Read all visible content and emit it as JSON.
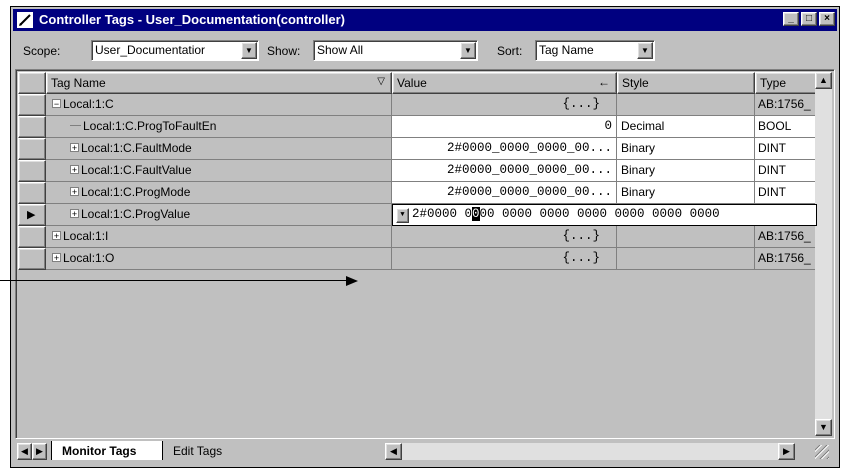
{
  "window": {
    "title": "Controller Tags - User_Documentation(controller)"
  },
  "toolbar": {
    "scope_label": "Scope:",
    "scope_value": "User_Documentatior",
    "show_label": "Show:",
    "show_value": "Show All",
    "sort_label": "Sort:",
    "sort_value": "Tag Name"
  },
  "grid": {
    "headers": {
      "tag_name": "Tag Name",
      "value": "Value",
      "style": "Style",
      "type": "Type"
    },
    "rows": [
      {
        "tag": "Local:1:C",
        "value": "{...}",
        "style": "",
        "type": "AB:1756_",
        "tree": "minus",
        "indent": 0
      },
      {
        "tag": "Local:1:C.ProgToFaultEn",
        "value": "0",
        "style": "Decimal",
        "type": "BOOL",
        "tree": "leaf",
        "indent": 1
      },
      {
        "tag": "Local:1:C.FaultMode",
        "value": "2#0000_0000_0000_00...",
        "style": "Binary",
        "type": "DINT",
        "tree": "plus",
        "indent": 1
      },
      {
        "tag": "Local:1:C.FaultValue",
        "value": "2#0000_0000_0000_00...",
        "style": "Binary",
        "type": "DINT",
        "tree": "plus",
        "indent": 1
      },
      {
        "tag": "Local:1:C.ProgMode",
        "value": "2#0000_0000_0000_00...",
        "style": "Binary",
        "type": "DINT",
        "tree": "plus",
        "indent": 1
      },
      {
        "tag": "Local:1:C.ProgValue",
        "value": "2#0000_0000_0000_0000_0000_0000_0000_0000",
        "style": "",
        "type": "",
        "tree": "plus",
        "indent": 1
      },
      {
        "tag": "Local:1:I",
        "value": "{...}",
        "style": "",
        "type": "AB:1756_",
        "tree": "plus",
        "indent": 0
      },
      {
        "tag": "Local:1:O",
        "value": "{...}",
        "style": "",
        "type": "AB:1756_",
        "tree": "plus",
        "indent": 0
      }
    ],
    "edit_value": {
      "before": "2#0000 0",
      "cursor": "0",
      "after": "00 0000 0000 0000 0000 0000 0000"
    }
  },
  "tabs": {
    "monitor": "Monitor Tags",
    "edit": "Edit Tags"
  },
  "colors": {
    "title_bar": "#000080",
    "face": "#c0c0c0"
  }
}
